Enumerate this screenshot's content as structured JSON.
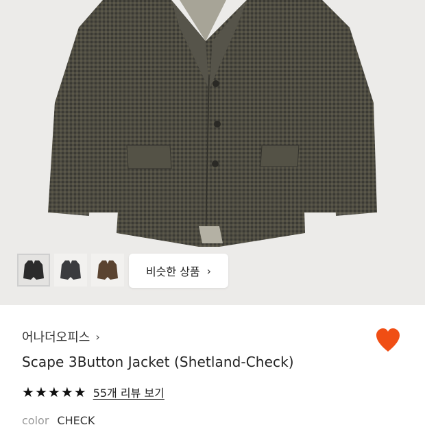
{
  "product_image": {
    "alt_icon": "jacket-image"
  },
  "thumbnails": [
    {
      "name": "thumbnail-black-jacket",
      "color": "#2b2b2b",
      "selected": true
    },
    {
      "name": "thumbnail-charcoal-jacket",
      "color": "#3a3b3e",
      "selected": false
    },
    {
      "name": "thumbnail-brown-jacket",
      "color": "#5a4330",
      "selected": false
    }
  ],
  "similar_button": {
    "label": "비슷한 상품",
    "chevron": "›"
  },
  "brand": {
    "name": "어나더오피스",
    "chevron": "›"
  },
  "wishlist": {
    "icon": "heart-icon",
    "color": "#f04e14"
  },
  "product": {
    "name": "Scape 3Button Jacket (Shetland-Check)"
  },
  "rating": {
    "stars": 5,
    "star_glyph": "★",
    "review_text": "55개 리뷰 보기"
  },
  "color_option": {
    "label": "color",
    "value": "CHECK"
  }
}
